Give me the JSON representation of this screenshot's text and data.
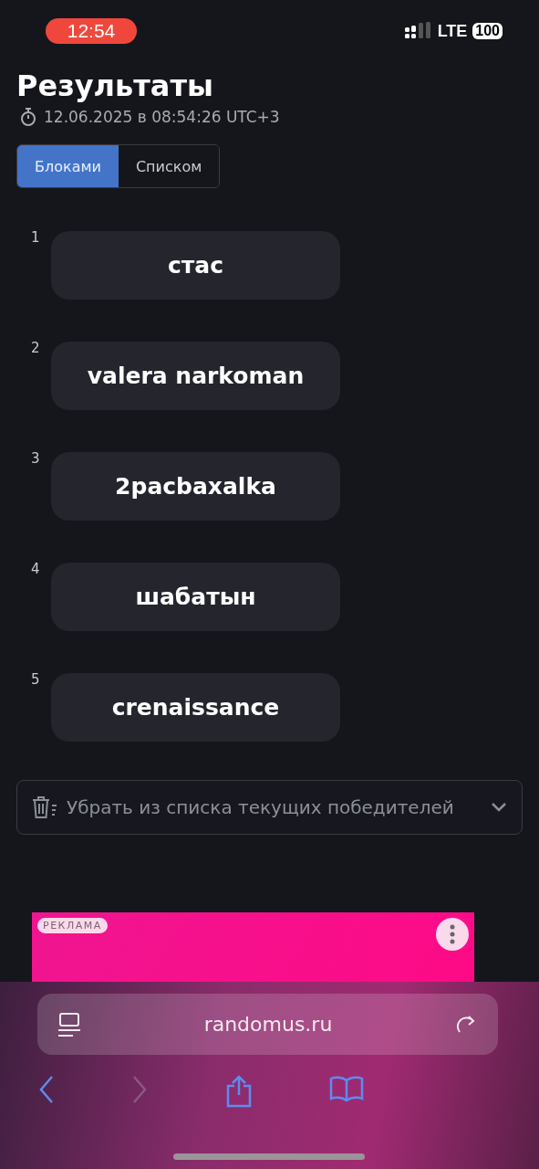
{
  "status_bar": {
    "time": "12:54",
    "network": "LTE",
    "battery": "100"
  },
  "title": "Результаты",
  "timestamp": "12.06.2025 в 08:54:26 UTC+3",
  "tabs": [
    {
      "label": "Блоками",
      "selected": true
    },
    {
      "label": "Списком",
      "selected": false
    }
  ],
  "results": [
    {
      "number": "1",
      "name": "стас"
    },
    {
      "number": "2",
      "name": "valera narkoman"
    },
    {
      "number": "3",
      "name": "2pacbaxalka"
    },
    {
      "number": "4",
      "name": "шабатын"
    },
    {
      "number": "5",
      "name": "crenaissance"
    }
  ],
  "remove_dropdown": {
    "label": "Убрать из списка текущих победителей",
    "expanded": false
  },
  "ad": {
    "badge": "РЕКЛАМА"
  },
  "browser": {
    "url": "randomus.ru"
  }
}
